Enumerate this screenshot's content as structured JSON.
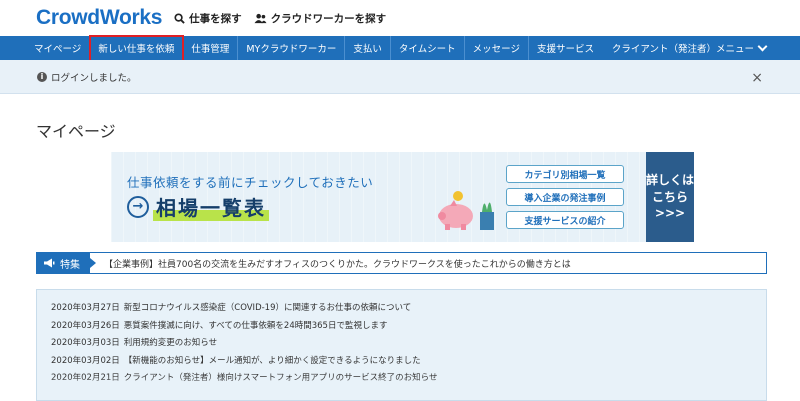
{
  "header": {
    "logo": "CrowdWorks",
    "links": [
      "仕事を探す",
      "クラウドワーカーを探す"
    ]
  },
  "nav": {
    "items": [
      "マイページ",
      "新しい仕事を依頼",
      "仕事管理",
      "MYクラウドワーカー",
      "支払い",
      "タイムシート",
      "メッセージ",
      "支援サービス"
    ],
    "right_menu": "クライアント（発注者）メニュー"
  },
  "notice": {
    "text": "ログインしました。",
    "close": "×"
  },
  "page": {
    "title": "マイページ"
  },
  "banner": {
    "subtitle": "仕事依頼をする前にチェックしておきたい",
    "title": "相場一覧表",
    "buttons": [
      "カテゴリ別相場一覧",
      "導入企業の発注事例",
      "支援サービスの紹介"
    ],
    "side": [
      "詳しくは",
      "こちら",
      ">>>"
    ]
  },
  "feature": {
    "tag": "特集",
    "text": "【企業事例】社員700名の交流を生みだすオフィスのつくりかた。クラウドワークスを使ったこれからの働き方とは"
  },
  "news": [
    {
      "date": "2020年03月27日",
      "text": "新型コロナウイルス感染症（COVID-19）に関連するお仕事の依頼について"
    },
    {
      "date": "2020年03月26日",
      "text": "悪質案件撲滅に向け、すべての仕事依頼を24時間365日で監視します"
    },
    {
      "date": "2020年03月03日",
      "text": "利用規約変更のお知らせ"
    },
    {
      "date": "2020年03月02日",
      "text": "【新機能のお知らせ】メール通知が、より細かく設定できるようになりました"
    },
    {
      "date": "2020年02月21日",
      "text": "クライアント（発注者）様向けスマートフォン用アプリのサービス終了のお知らせ"
    }
  ],
  "colors": {
    "brand": "#1f6fba",
    "highlight": "#e01f25"
  }
}
